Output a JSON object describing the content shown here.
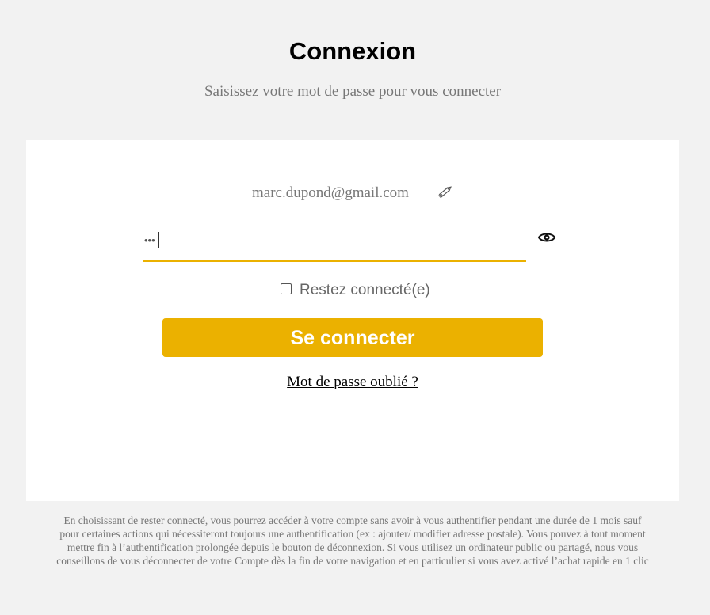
{
  "header": {
    "title": "Connexion",
    "subtitle": "Saisissez votre mot de passe pour vous connecter"
  },
  "login": {
    "email": "marc.dupond@gmail.com",
    "edit_icon": "pencil-icon",
    "password_value": "•••",
    "password_visibility_icon": "eye-icon",
    "remember_label": "Restez connecté(e)",
    "remember_checked": false,
    "submit_label": "Se connecter",
    "forgot_label": "Mot de passe oublié ?"
  },
  "footnote": {
    "text": "En choisissant de rester connecté, vous pourrez accéder à votre compte sans avoir à vous authentifier pendant une durée de 1 mois sauf pour certaines actions qui nécessiteront toujours une authentification (ex : ajouter/ modifier adresse postale). Vous pouvez à tout moment mettre fin à l’authentification prolongée depuis le bouton de déconnexion. Si vous utilisez un ordinateur public ou partagé, nous vous conseillons de vous déconnecter de votre Compte dès la fin de votre navigation et en particulier si vous avez activé l’achat rapide en 1 clic"
  },
  "colors": {
    "accent": "#ebb100",
    "background": "#f2f2f2",
    "card": "#ffffff",
    "muted_text": "#777777"
  }
}
